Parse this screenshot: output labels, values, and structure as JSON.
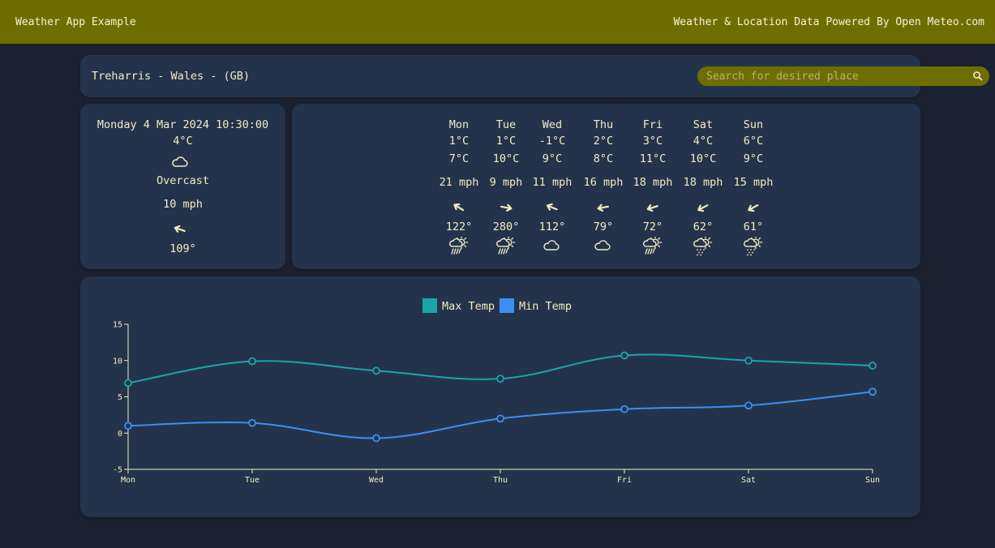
{
  "header": {
    "title": "Weather App Example",
    "credit": "Weather & Location Data Powered By Open Meteo.com"
  },
  "location": {
    "name": "Treharris - Wales - (GB)"
  },
  "search": {
    "placeholder": "Search for desired place",
    "value": "",
    "icon": "search-icon"
  },
  "current": {
    "datetime": "Monday 4 Mar 2024 10:30:00",
    "temperature": "4°C",
    "icon": "cloud-icon",
    "condition": "Overcast",
    "wind_speed": "10 mph",
    "wind_direction_deg": 109,
    "wind_direction": "109°"
  },
  "forecast": [
    {
      "day": "Mon",
      "min": "1°C",
      "max": "7°C",
      "wind": "21 mph",
      "dir_deg": 122,
      "dir": "122°",
      "icon": "sun-rain-icon"
    },
    {
      "day": "Tue",
      "min": "1°C",
      "max": "10°C",
      "wind": "9 mph",
      "dir_deg": 280,
      "dir": "280°",
      "icon": "sun-rain-icon"
    },
    {
      "day": "Wed",
      "min": "-1°C",
      "max": "9°C",
      "wind": "11 mph",
      "dir_deg": 112,
      "dir": "112°",
      "icon": "cloud-icon"
    },
    {
      "day": "Thu",
      "min": "2°C",
      "max": "8°C",
      "wind": "16 mph",
      "dir_deg": 79,
      "dir": "79°",
      "icon": "cloud-icon"
    },
    {
      "day": "Fri",
      "min": "3°C",
      "max": "11°C",
      "wind": "18 mph",
      "dir_deg": 72,
      "dir": "72°",
      "icon": "sun-rain-icon"
    },
    {
      "day": "Sat",
      "min": "4°C",
      "max": "10°C",
      "wind": "18 mph",
      "dir_deg": 62,
      "dir": "62°",
      "icon": "sun-drizzle-icon"
    },
    {
      "day": "Sun",
      "min": "6°C",
      "max": "9°C",
      "wind": "15 mph",
      "dir_deg": 61,
      "dir": "61°",
      "icon": "sun-drizzle-icon"
    }
  ],
  "colors": {
    "header_bg": "#6e6e00",
    "page_bg": "#1b2131",
    "card_bg": "#24334c",
    "text": "#f2ecc4",
    "max_series": "#1aa6a8",
    "min_series": "#3d8fef"
  },
  "chart_data": {
    "type": "line",
    "categories": [
      "Mon",
      "Tue",
      "Wed",
      "Thu",
      "Fri",
      "Sat",
      "Sun"
    ],
    "series": [
      {
        "name": "Max Temp",
        "values": [
          6.9,
          9.9,
          8.6,
          7.5,
          10.7,
          10.0,
          9.3
        ]
      },
      {
        "name": "Min Temp",
        "values": [
          1.0,
          1.4,
          -0.7,
          2.0,
          3.3,
          3.8,
          5.7
        ]
      }
    ],
    "ylim": [
      -5,
      15
    ],
    "yticks": [
      -5,
      0,
      5,
      10,
      15
    ],
    "legend": "top-center",
    "grid": false
  }
}
